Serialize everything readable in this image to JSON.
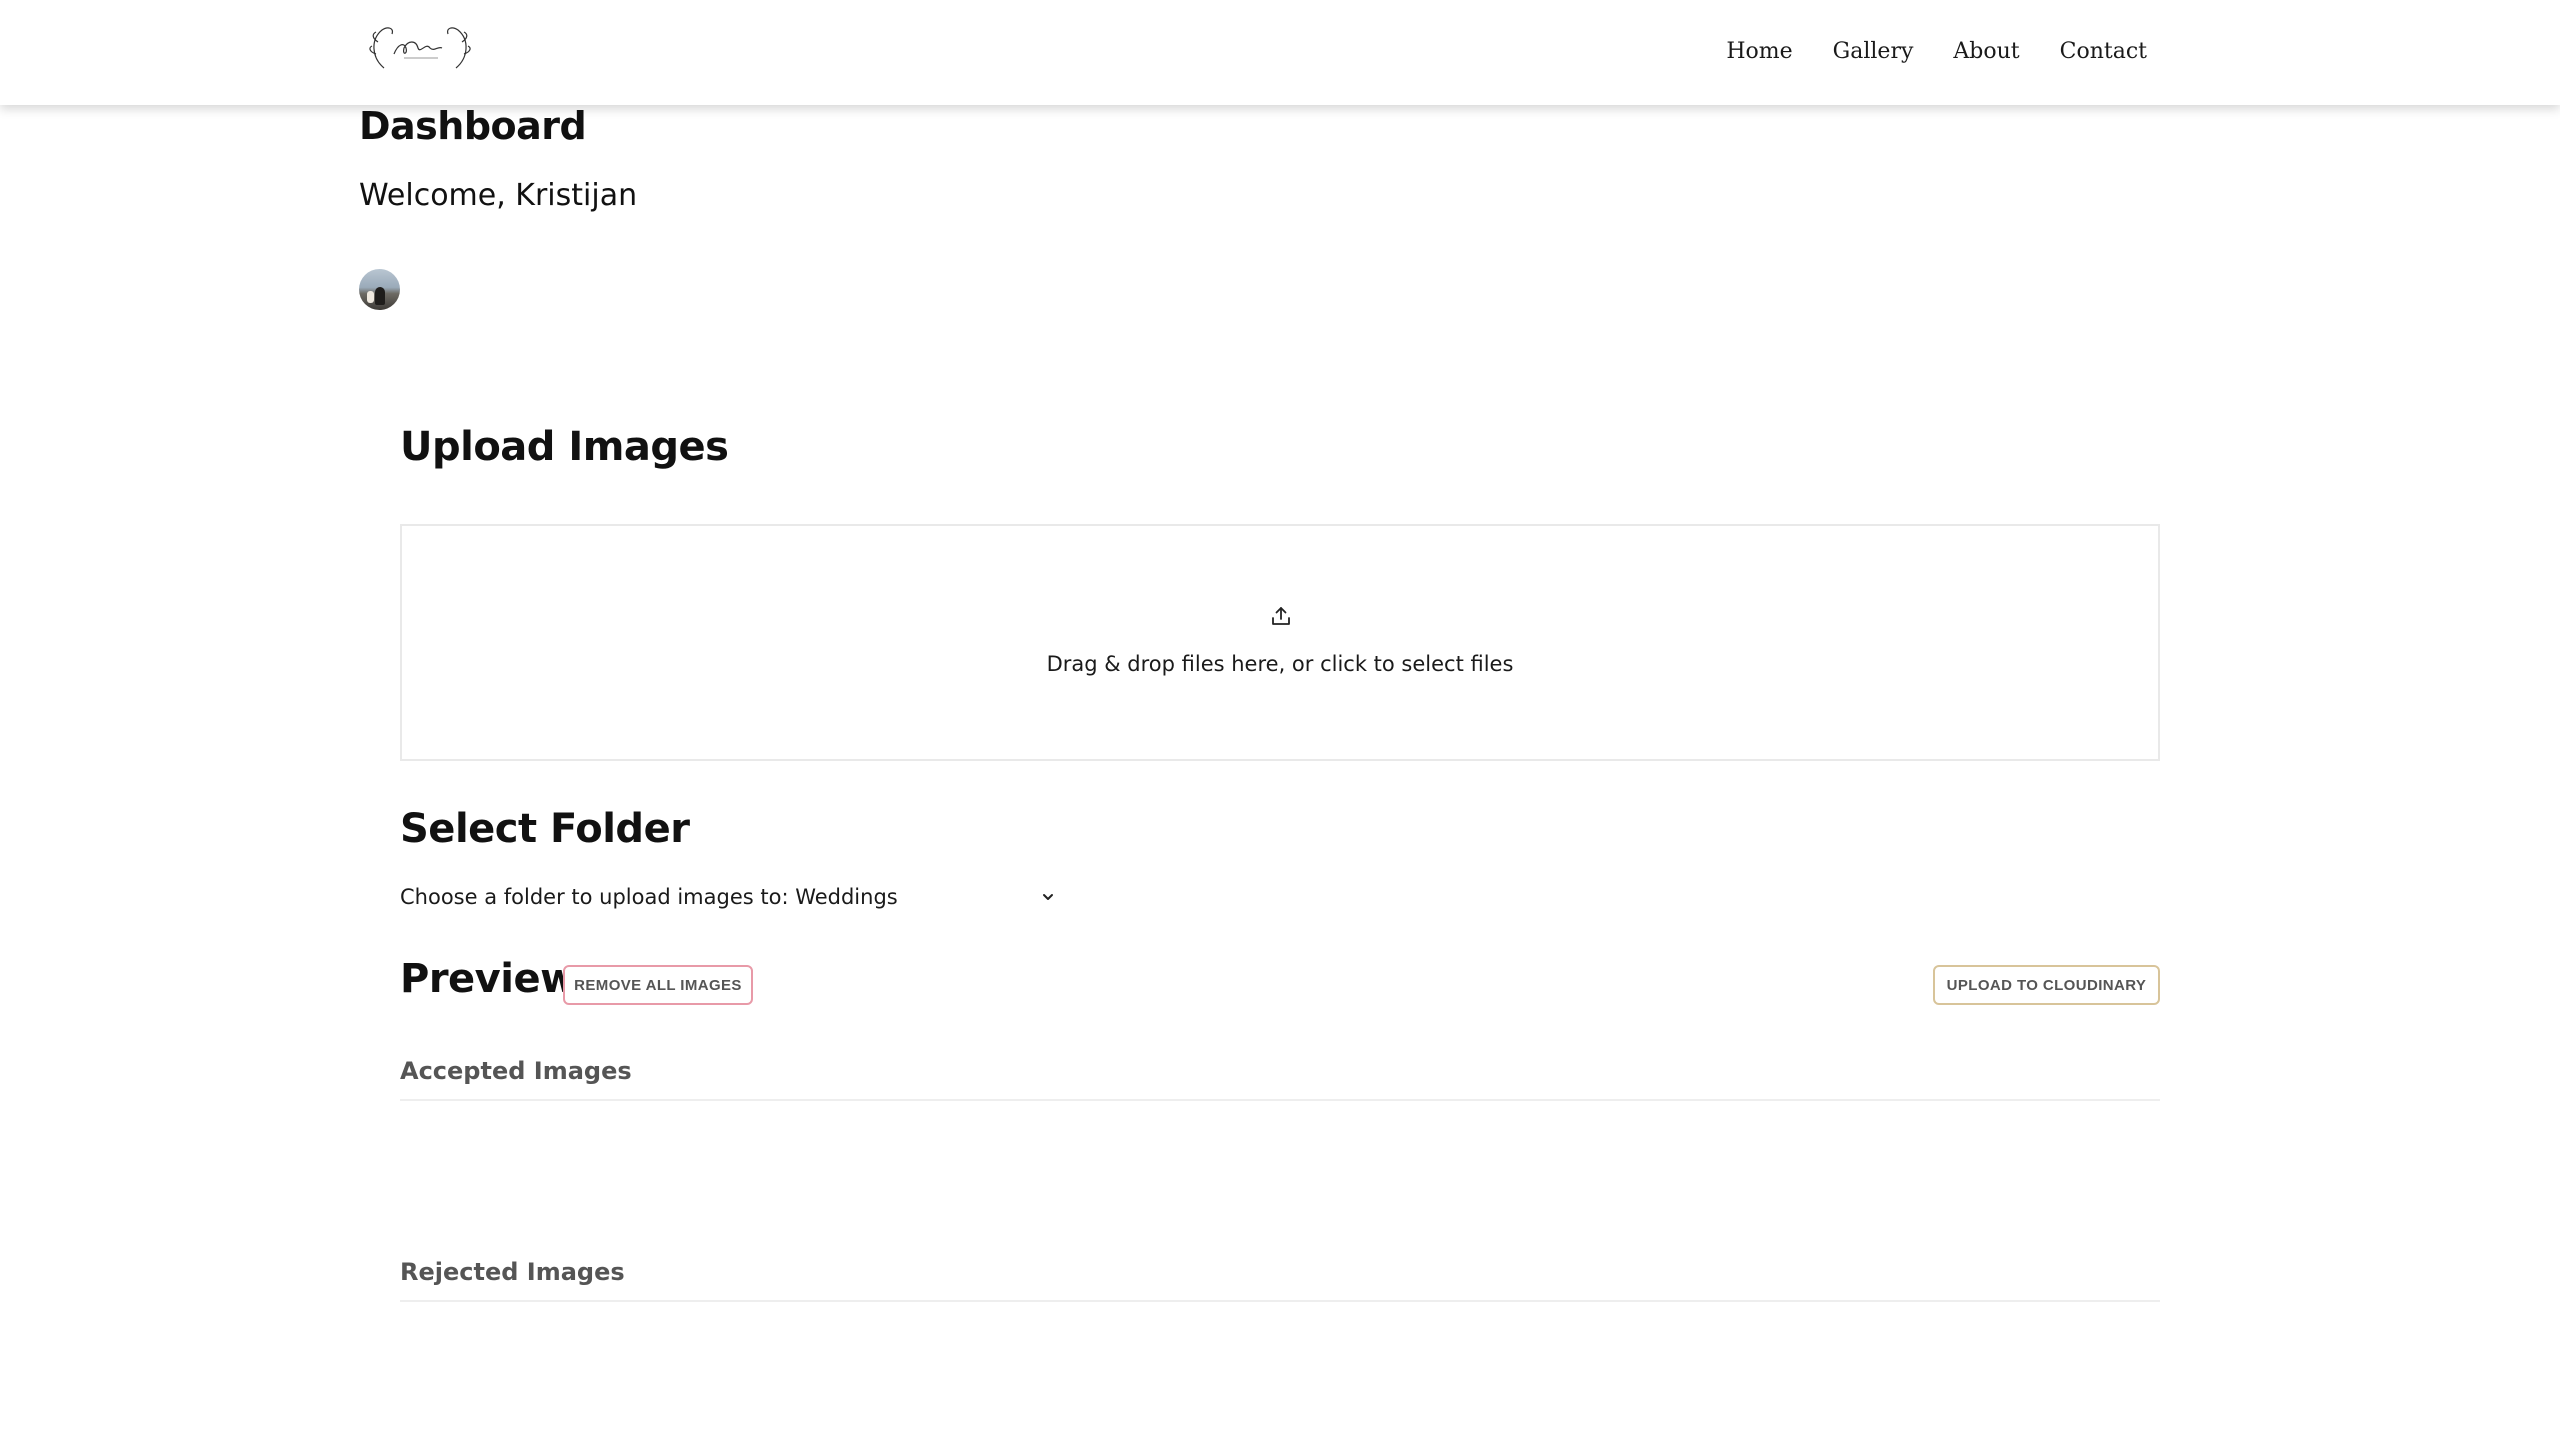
{
  "nav": {
    "logo_icon": "floral-script-logo",
    "links": [
      "Home",
      "Gallery",
      "About",
      "Contact"
    ]
  },
  "dashboard": {
    "title": "Dashboard",
    "welcome": "Welcome, Kristijan",
    "avatar_icon": "user-avatar"
  },
  "upload": {
    "title": "Upload Images",
    "dropzone_icon": "upload-icon",
    "dropzone_text": "Drag & drop files here, or click to select files"
  },
  "folder": {
    "title": "Select Folder",
    "select_label": "Choose a folder to upload images to: Weddings",
    "chevron_icon": "chevron-down-icon"
  },
  "preview": {
    "title": "Preview",
    "remove_all_label": "REMOVE ALL IMAGES",
    "upload_cloudinary_label": "UPLOAD TO CLOUDINARY",
    "accepted_heading": "Accepted Images",
    "rejected_heading": "Rejected Images"
  },
  "colors": {
    "remove_border": "#e89aa8",
    "upload_border": "#d8c49a",
    "dropzone_border": "#e9e9e9"
  }
}
